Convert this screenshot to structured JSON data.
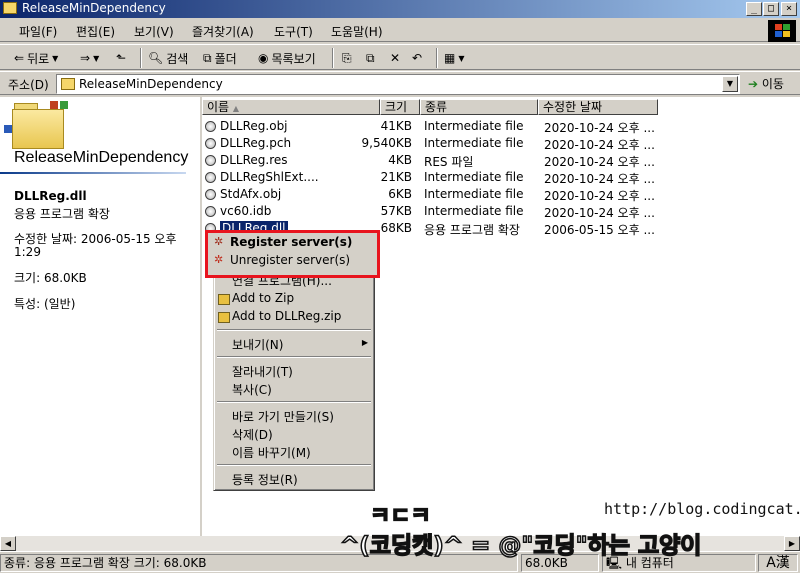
{
  "window": {
    "title": "ReleaseMinDependency",
    "minimize": "_",
    "maximize": "□",
    "close": "×"
  },
  "menu": [
    "파일(F)",
    "편집(E)",
    "보기(V)",
    "즐겨찾기(A)",
    "도구(T)",
    "도움말(H)"
  ],
  "toolbar": {
    "back": "뒤로",
    "search": "검색",
    "folders": "폴더",
    "views": "목록보기"
  },
  "address": {
    "label": "주소(D)",
    "value": "ReleaseMinDependency",
    "go": "이동"
  },
  "left_pane": {
    "folder_title": "ReleaseMinDependency",
    "file_name": "DLLReg.dll",
    "file_type": "응용 프로그램 확장",
    "modified_line1": "수정한 날짜: 2006-05-15 오후",
    "modified_line2": "1:29",
    "size": "크기: 68.0KB",
    "attributes": "특성: (일반)"
  },
  "columns": {
    "name": "이름",
    "size": "크기",
    "type": "종류",
    "date": "수정한 날짜"
  },
  "files": [
    {
      "name": "DLLReg.obj",
      "size": "41KB",
      "type": "Intermediate file",
      "date": "2020-10-24 오후 ..."
    },
    {
      "name": "DLLReg.pch",
      "size": "9,540KB",
      "type": "Intermediate file",
      "date": "2020-10-24 오후 ..."
    },
    {
      "name": "DLLReg.res",
      "size": "4KB",
      "type": "RES 파일",
      "date": "2020-10-24 오후 ..."
    },
    {
      "name": "DLLRegShlExt....",
      "size": "21KB",
      "type": "Intermediate file",
      "date": "2020-10-24 오후 ..."
    },
    {
      "name": "StdAfx.obj",
      "size": "6KB",
      "type": "Intermediate file",
      "date": "2020-10-24 오후 ..."
    },
    {
      "name": "vc60.idb",
      "size": "57KB",
      "type": "Intermediate file",
      "date": "2020-10-24 오후 ..."
    },
    {
      "name": "DLLReg.dll",
      "size": "68KB",
      "type": "응용 프로그램 확장",
      "date": "2006-05-15 오후 ..."
    }
  ],
  "context_menu": {
    "register": "Register server(s)",
    "unregister": "Unregister server(s)",
    "open_with": "연결 프로그램(H)...",
    "add_zip": "Add to Zip",
    "add_named_zip": "Add to DLLReg.zip",
    "send_to": "보내기(N)",
    "cut": "잘라내기(T)",
    "copy": "복사(C)",
    "shortcut": "바로 가기 만들기(S)",
    "delete": "삭제(D)",
    "rename": "이름 바꾸기(M)",
    "properties": "등록 정보(R)"
  },
  "status": {
    "text": "종류: 응용 프로그램 확장 크기: 68.0KB",
    "size": "68.0KB",
    "location": "내 컴퓨터"
  },
  "watermark": {
    "logo": "ㅋㄷㅋ",
    "tagline": "^(코딩캣)^ = @\"코딩\"하는 고양이",
    "url": "http://blog.codingcat.kr/"
  }
}
